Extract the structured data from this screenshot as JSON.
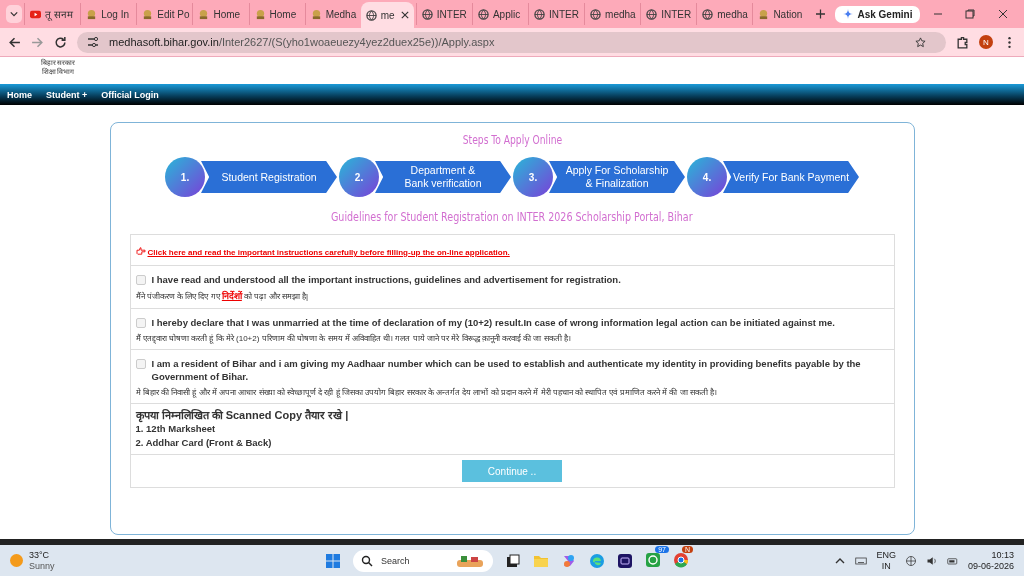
{
  "browser": {
    "tabs": [
      {
        "label": "तू सनम",
        "kind": "video",
        "selected": false
      },
      {
        "label": "Log In",
        "kind": "site",
        "selected": false
      },
      {
        "label": "Edit Po",
        "kind": "site",
        "selected": false
      },
      {
        "label": "Home",
        "kind": "site",
        "selected": false
      },
      {
        "label": "Home",
        "kind": "site",
        "selected": false
      },
      {
        "label": "Medha",
        "kind": "site",
        "selected": false
      },
      {
        "label": "me",
        "kind": "globe",
        "selected": true
      },
      {
        "label": "INTER",
        "kind": "globe",
        "selected": false
      },
      {
        "label": "Applic",
        "kind": "globe",
        "selected": false
      },
      {
        "label": "INTER",
        "kind": "globe",
        "selected": false
      },
      {
        "label": "medha",
        "kind": "globe",
        "selected": false
      },
      {
        "label": "INTER",
        "kind": "globe",
        "selected": false
      },
      {
        "label": "medha",
        "kind": "globe",
        "selected": false
      },
      {
        "label": "Nation",
        "kind": "site",
        "selected": false
      }
    ],
    "gemini": "Ask Gemini",
    "url_host": "medhasoft.bihar.gov.in",
    "url_path": "/Inter2627/(S(yho1woaeuezy4yez2duex25e))/Apply.aspx",
    "profile": "N"
  },
  "header": {
    "logo_lines": [
      "बिहार सरकार",
      "शिक्षा विभाग"
    ]
  },
  "nav": [
    {
      "label": "Home"
    },
    {
      "label": "Student +"
    },
    {
      "label": "Official Login"
    }
  ],
  "steps_title": "Steps To Apply Online",
  "steps": [
    {
      "number": "1.",
      "label": "Student Registration"
    },
    {
      "number": "2.",
      "label": "Department &\nBank verification"
    },
    {
      "number": "3.",
      "label": "Apply For Scholarship\n& Finalization"
    },
    {
      "number": "4.",
      "label": "Verify For Bank Payment"
    }
  ],
  "guidelines_title": "Guidelines for Student Registration on INTER 2026 Scholarship Portal, Bihar",
  "instructions_link": "Click here and read the important instructions carefully before filling-up the on-line application.",
  "declarations": [
    {
      "checked": false,
      "english": "I have read and understood all the important instructions, guidelines and advertisement for registration.",
      "hindi_before": "मैंने पंजीकरण के लिए दिए गए ",
      "hindi_link": "निर्देशों",
      "hindi_after": " को पढ़ा और समझा है|"
    },
    {
      "checked": false,
      "english": "I hereby declare that I was unmarried at the time of declaration of my (10+2) result.In case of wrong information legal action can be initiated against me.",
      "hindi_before": "मैं एतद्द्वारा घोषणा करती हूं कि मेरे (10+2) परिणाम की घोषणा के समय में अविवाहित थी। गलत पाये जाने पर मेरे विरूद्ध क़ानूनी करवाई की जा सकती है।"
    },
    {
      "checked": false,
      "english": "I am a resident of Bihar and i am giving my Aadhaar number which can be used to establish and authenticate my identity in providing benefits payable by the Government of Bihar.",
      "hindi_before": "मे बिहार की निवासी हूं और में अपना आधार संख्या को स्वेच्छापूर्ण दे रही हूं जिसका उपयोग बिहार सरकार के अन्तर्गत देय लाभों को प्रदान करने में मेरी पहचान को स्थापित एवं प्रमाणित करने में की जा सकती है।"
    }
  ],
  "documents": {
    "heading": "कृपया निम्नलिखित की Scanned Copy तैयार रखे |",
    "items": [
      "1. 12th Marksheet",
      "2. Addhar Card (Front & Back)"
    ]
  },
  "continue_button": "Continue ..",
  "taskbar": {
    "temperature": "33°C",
    "weather": "Sunny",
    "search": "Search",
    "whatsapp_badge": "97",
    "chrome_badge": "N",
    "language": "ENG",
    "region": "IN",
    "time": "10:13",
    "date": "09-06-2026"
  }
}
